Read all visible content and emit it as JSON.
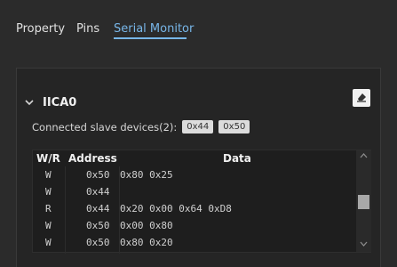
{
  "tabs": [
    {
      "label": "Property"
    },
    {
      "label": "Pins"
    },
    {
      "label": "Serial Monitor"
    }
  ],
  "section": {
    "title": "IICA0",
    "slaves_label": "Connected slave devices(2):",
    "slaves": [
      "0x44",
      "0x50"
    ]
  },
  "table": {
    "headers": {
      "wr": "W/R",
      "address": "Address",
      "data": "Data"
    },
    "rows": [
      {
        "wr": "W",
        "address": "0x50",
        "data": "0x80 0x25"
      },
      {
        "wr": "W",
        "address": "0x44",
        "data": ""
      },
      {
        "wr": "R",
        "address": "0x44",
        "data": "0x20 0x00 0x64 0xD8"
      },
      {
        "wr": "W",
        "address": "0x50",
        "data": "0x00 0x80"
      },
      {
        "wr": "W",
        "address": "0x50",
        "data": "0x80 0x20"
      }
    ]
  },
  "icons": {
    "collapse": "chevron-down-icon",
    "clear": "eraser-icon"
  },
  "colors": {
    "accent": "#78b6e8",
    "background": "#2b2b2b"
  }
}
